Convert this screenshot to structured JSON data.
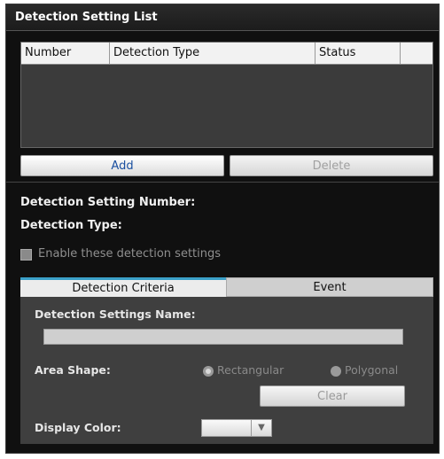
{
  "list_panel": {
    "title": "Detection Setting List",
    "columns": [
      "Number",
      "Detection Type",
      "Status"
    ],
    "rows": []
  },
  "buttons": {
    "add": "Add",
    "delete": "Delete"
  },
  "details": {
    "number_label": "Detection Setting Number:",
    "type_label": "Detection Type:",
    "enable_label": "Enable these detection settings"
  },
  "tabs": [
    {
      "label": "Detection Criteria",
      "active": true
    },
    {
      "label": "Event",
      "active": false
    }
  ],
  "criteria": {
    "name_label": "Detection Settings Name:",
    "name_value": "",
    "area_shape_label": "Area Shape:",
    "shape_options": [
      "Rectangular",
      "Polygonal"
    ],
    "shape_selected": "Rectangular",
    "clear_label": "Clear",
    "display_color_label": "Display Color:"
  },
  "colors": {
    "tab_accent": "#3aa0c8",
    "add_text": "#1a4fa0"
  },
  "icons": {
    "dropdown": "chevron-down-icon"
  }
}
